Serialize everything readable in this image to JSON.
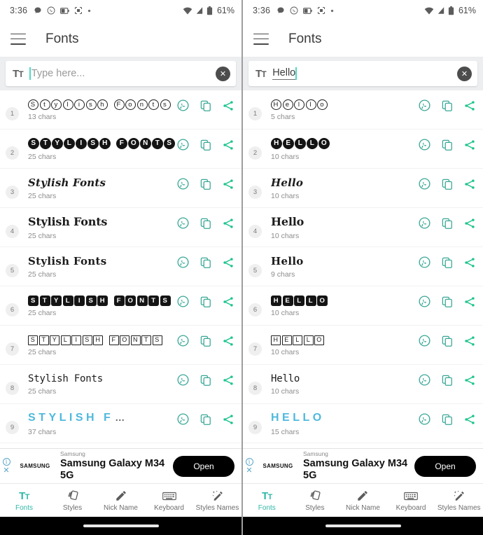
{
  "statusbar": {
    "time": "3:36",
    "battery": "61%",
    "left_icons": [
      "chat-bubble-icon",
      "whatsapp-icon",
      "battery-saver-icon",
      "screenshot-icon",
      "dot-icon"
    ],
    "right_icons": [
      "wifi-icon",
      "signal-icon",
      "battery-icon"
    ]
  },
  "appbar": {
    "title": "Fonts",
    "menu_icon": "hamburger-menu-icon"
  },
  "colors": {
    "accent_teal": "#2fb8a8",
    "action_icon": "#3aa797",
    "caret": "#4fd8c4",
    "sample_blue": "#4fb9dd",
    "search_bg": "#eceef0"
  },
  "search": {
    "prefix_icon": "text-format-icon",
    "placeholder": "Type here...",
    "clear_icon": "clear-text-icon",
    "left_value": "",
    "right_value": "Hello"
  },
  "row_actions": [
    "whatsapp-share-icon",
    "copy-icon",
    "share-icon"
  ],
  "left_panel": {
    "rows": [
      {
        "n": "1",
        "style": "circle-outline",
        "text": "Stylish Fonts",
        "chars": "13 chars",
        "truncated": false
      },
      {
        "n": "2",
        "style": "circle-fill",
        "text": "STYLISH FONTS",
        "chars": "25 chars",
        "truncated": false
      },
      {
        "n": "3",
        "style": "script",
        "text": "Stylish Fonts",
        "chars": "25 chars",
        "truncated": false
      },
      {
        "n": "4",
        "style": "gothic",
        "text": "Stylish Fonts",
        "chars": "25 chars",
        "truncated": false
      },
      {
        "n": "5",
        "style": "serif",
        "text": "Stylish Fonts",
        "chars": "25 chars",
        "truncated": false
      },
      {
        "n": "6",
        "style": "square-fill",
        "text": "STYLISH FONTS",
        "chars": "25 chars",
        "truncated": false
      },
      {
        "n": "7",
        "style": "square-outline",
        "text": "STYLISH FONTS",
        "chars": "25 chars",
        "truncated": false
      },
      {
        "n": "8",
        "style": "mono",
        "text": "Stylish Fonts",
        "chars": "25 chars",
        "truncated": false
      },
      {
        "n": "9",
        "style": "wide-blue",
        "text": "STYLISH F",
        "chars": "37 chars",
        "truncated": true
      }
    ]
  },
  "right_panel": {
    "rows": [
      {
        "n": "1",
        "style": "circle-outline",
        "text": "Hello",
        "chars": "5 chars",
        "truncated": false
      },
      {
        "n": "2",
        "style": "circle-fill",
        "text": "HELLO",
        "chars": "10 chars",
        "truncated": false
      },
      {
        "n": "3",
        "style": "script",
        "text": "Hello",
        "chars": "10 chars",
        "truncated": false
      },
      {
        "n": "4",
        "style": "gothic",
        "text": "Hello",
        "chars": "10 chars",
        "truncated": false
      },
      {
        "n": "5",
        "style": "serif",
        "text": "Hello",
        "chars": "9 chars",
        "truncated": false
      },
      {
        "n": "6",
        "style": "square-fill",
        "text": "HELLO",
        "chars": "10 chars",
        "truncated": false
      },
      {
        "n": "7",
        "style": "square-outline",
        "text": "HELLO",
        "chars": "10 chars",
        "truncated": false
      },
      {
        "n": "8",
        "style": "mono",
        "text": "Hello",
        "chars": "10 chars",
        "truncated": false
      },
      {
        "n": "9",
        "style": "wide-blue",
        "text": "HELLO",
        "chars": "15 chars",
        "truncated": false
      }
    ]
  },
  "ad": {
    "advertiser": "Samsung",
    "brand_logo": "SAMSUNG",
    "title": "Samsung Galaxy M34 5G",
    "button": "Open",
    "info_icon": "ad-info-icon",
    "close_icon": "ad-close-icon"
  },
  "bottomnav": {
    "items": [
      {
        "label": "Fonts",
        "icon": "text-format-icon",
        "active": true
      },
      {
        "label": "Styles",
        "icon": "cards-icon",
        "active": false
      },
      {
        "label": "Nick Name",
        "icon": "pencil-icon",
        "active": false
      },
      {
        "label": "Keyboard",
        "icon": "keyboard-icon",
        "active": false
      },
      {
        "label": "Styles Names",
        "icon": "magic-pencil-icon",
        "active": false
      }
    ]
  }
}
